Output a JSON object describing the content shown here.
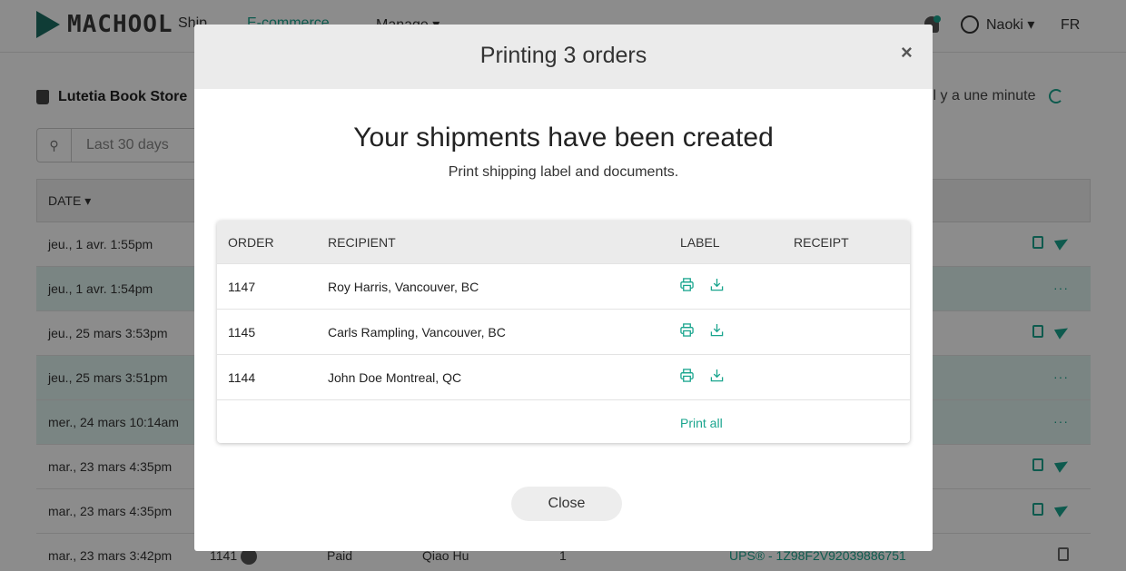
{
  "nav": {
    "logo": "MACHOOL",
    "ship": "Ship",
    "ecommerce": "E-commerce",
    "manage": "Manage ▾",
    "user": "Naoki ▾",
    "lang": "FR"
  },
  "store": {
    "name": "Lutetia Book Store",
    "updated": "il y a une minute"
  },
  "search": {
    "value": "Last 30 days"
  },
  "table": {
    "date_header": "DATE ▾",
    "rows": [
      {
        "date": "jeu., 1 avr. 1:55pm"
      },
      {
        "date": "jeu., 1 avr. 1:54pm"
      },
      {
        "date": "jeu., 25 mars 3:53pm"
      },
      {
        "date": "jeu., 25 mars 3:51pm"
      },
      {
        "date": "mer., 24 mars 10:14am"
      },
      {
        "date": "mar., 23 mars 4:35pm"
      },
      {
        "date": "mar., 23 mars 4:35pm"
      },
      {
        "date": "mar., 23 mars 3:42pm",
        "order": "1141",
        "status": "Paid",
        "customer": "Qiao Hu",
        "qty": "1",
        "tracking": "UPS® - 1Z98F2V92039886751"
      }
    ]
  },
  "modal": {
    "title": "Printing 3 orders",
    "close_symbol": "×",
    "heading": "Your shipments have been created",
    "subheading": "Print shipping label and documents.",
    "columns": {
      "order": "ORDER",
      "recipient": "RECIPIENT",
      "label": "LABEL",
      "receipt": "RECEIPT"
    },
    "orders": [
      {
        "order": "1147",
        "recipient": "Roy Harris, Vancouver, BC"
      },
      {
        "order": "1145",
        "recipient": "Carls Rampling, Vancouver, BC"
      },
      {
        "order": "1144",
        "recipient": "John Doe Montreal, QC"
      }
    ],
    "print_all": "Print all",
    "close_button": "Close"
  },
  "colors": {
    "accent": "#1aa58e",
    "header_bg": "#ebebeb"
  },
  "icons": [
    "send-icon",
    "shopping-cart-icon",
    "document-icon",
    "bell-icon",
    "user-circle-icon",
    "shop-icon",
    "refresh-icon",
    "search-icon",
    "printer-icon",
    "download-icon",
    "close-icon"
  ]
}
